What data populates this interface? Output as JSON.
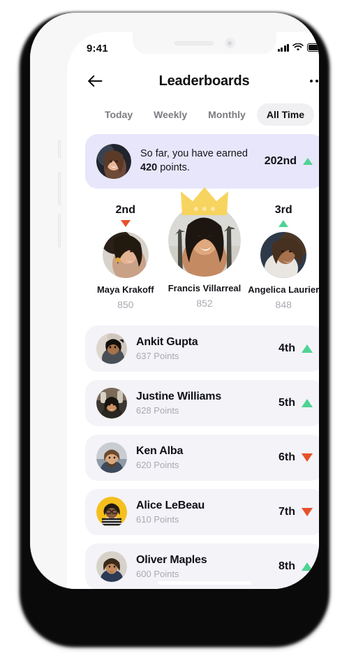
{
  "status_bar": {
    "time": "9:41",
    "signal_icon": "cellular-bars-icon",
    "wifi_icon": "wifi-icon",
    "battery_icon": "battery-full-icon"
  },
  "header": {
    "back_icon": "arrow-left-icon",
    "title": "Leaderboards",
    "more_icon": "ellipsis-icon"
  },
  "tabs": {
    "items": [
      {
        "label": "Today",
        "active": false
      },
      {
        "label": "Weekly",
        "active": false
      },
      {
        "label": "Monthly",
        "active": false
      },
      {
        "label": "All Time",
        "active": true
      }
    ]
  },
  "my_rank_card": {
    "avatar": "user-avatar",
    "text_before": "So far, you have earned ",
    "points": "420",
    "text_after": " points.",
    "full_text": "So far, you have earned 420 points.",
    "rank": "202nd",
    "trend": "up",
    "trend_icon": "triangle-up-icon",
    "background_color": "#e7e6fb"
  },
  "podium": [
    {
      "place": "2nd",
      "name": "Maya Krakoff",
      "score": "850",
      "trend": "down",
      "trend_icon": "triangle-down-icon",
      "avatar": "maya-avatar"
    },
    {
      "place": "1st",
      "name": "Francis Villarreal",
      "score": "852",
      "trend": "none",
      "crown_icon": "crown-icon",
      "avatar": "francis-avatar"
    },
    {
      "place": "3rd",
      "name": "Angelica Laurier",
      "score": "848",
      "trend": "up",
      "trend_icon": "triangle-up-icon",
      "avatar": "angelica-avatar"
    }
  ],
  "list": {
    "points_suffix": "Points",
    "rows": [
      {
        "name": "Ankit Gupta",
        "points": "637 Points",
        "rank": "4th",
        "trend": "up",
        "trend_icon": "triangle-up-icon",
        "avatar": "ankit-avatar"
      },
      {
        "name": "Justine Williams",
        "points": "628 Points",
        "rank": "5th",
        "trend": "up",
        "trend_icon": "triangle-up-icon",
        "avatar": "justine-avatar"
      },
      {
        "name": "Ken Alba",
        "points": "620 Points",
        "rank": "6th",
        "trend": "down",
        "trend_icon": "triangle-down-icon",
        "avatar": "ken-avatar"
      },
      {
        "name": "Alice LeBeau",
        "points": "610 Points",
        "rank": "7th",
        "trend": "down",
        "trend_icon": "triangle-down-icon",
        "avatar": "alice-avatar"
      },
      {
        "name": "Oliver Maples",
        "points": "600 Points",
        "rank": "8th",
        "trend": "up",
        "trend_icon": "triangle-up-icon",
        "avatar": "oliver-avatar"
      }
    ]
  },
  "colors": {
    "trend_up": "#50d394",
    "trend_down": "#e7512a",
    "crown": "#f7d45f",
    "card_lavender": "#e7e6fb",
    "row_bg": "#f3f3f8",
    "tab_active_bg": "#f0f0f3",
    "text_primary": "#101018",
    "text_muted": "#a9a9b2"
  },
  "home_indicator": "home-indicator"
}
